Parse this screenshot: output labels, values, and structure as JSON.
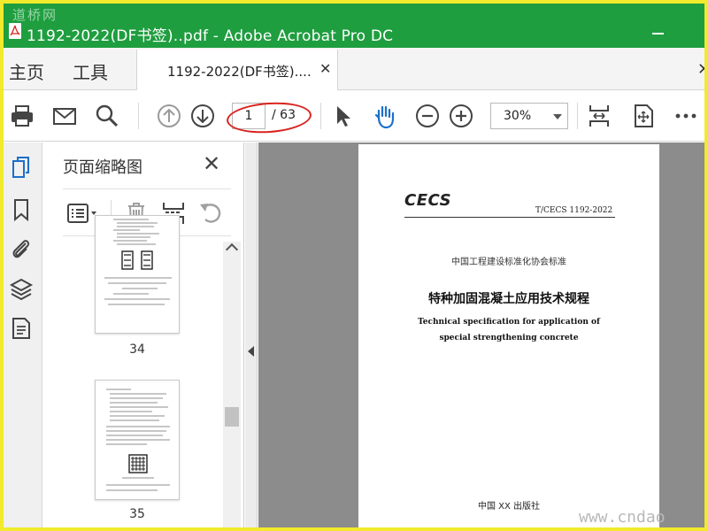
{
  "window": {
    "title": "1192-2022(DF书签)..pdf - Adobe Acrobat Pro DC",
    "watermark_top_left": "道桥网",
    "watermark_bottom_right": "www.cndao"
  },
  "menu": {
    "home_label": "主页",
    "tools_label": "工具"
  },
  "tab": {
    "label": "1192-2022(DF书签)....",
    "close_glyph": "✕"
  },
  "sidebar_close_glyph": "✕",
  "toolbar": {
    "current_page": "1",
    "total_pages": "/ 63",
    "zoom": "30%",
    "icons": [
      "print-icon",
      "email-icon",
      "search-icon",
      "page-up-icon",
      "page-down-icon",
      "select-pointer-icon",
      "hand-tool-icon",
      "zoom-out-icon",
      "zoom-in-icon",
      "fit-page-icon",
      "rotate-view-icon",
      "more-icon"
    ]
  },
  "rail": {
    "icons": [
      "page-thumbnails-icon",
      "bookmarks-icon",
      "attachments-icon",
      "layers-icon",
      "page-content-icon"
    ]
  },
  "thumbnails_panel": {
    "title": "页面缩略图",
    "close_glyph": "✕",
    "tools": [
      "thumbnail-options-icon",
      "delete-page-icon",
      "insert-page-icon",
      "undo-icon"
    ],
    "pages": [
      {
        "number": "34"
      },
      {
        "number": "35"
      }
    ]
  },
  "document": {
    "logo": "CECS",
    "standard_code": "T/CECS 1192-2022",
    "organization": "中国工程建设标准化协会标准",
    "title_cn": "特种加固混凝土应用技术规程",
    "title_en_line1": "Technical specification for application of",
    "title_en_line2": "special strengthening concrete",
    "publisher": "中国 XX 出版社"
  },
  "colors": {
    "title_bar": "#1f9e3f",
    "outer_border": "#f2ea2c",
    "annotation_ellipse": "#d9231f",
    "doc_background": "#8c8c8c"
  }
}
